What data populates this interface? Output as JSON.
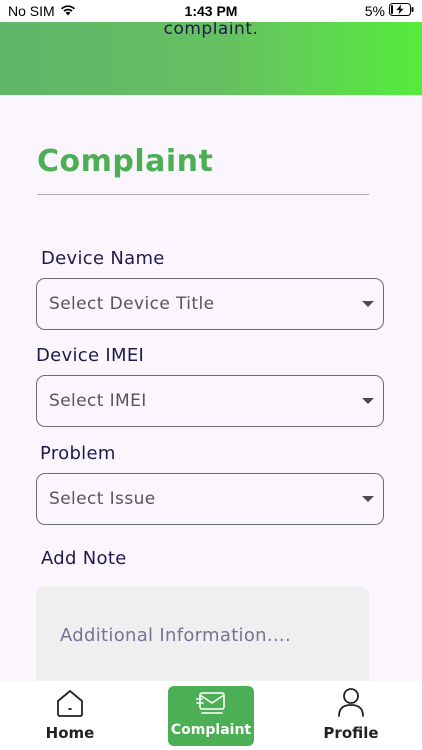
{
  "status_bar": {
    "carrier": "No SIM",
    "time": "1:43 PM",
    "battery": "5%"
  },
  "header": {
    "text": "complaint."
  },
  "form": {
    "title": "Complaint",
    "device_name": {
      "label": "Device Name",
      "placeholder": "Select Device Title"
    },
    "device_imei": {
      "label": "Device IMEI",
      "placeholder": "Select IMEI"
    },
    "problem": {
      "label": "Problem",
      "placeholder": "Select Issue"
    },
    "note": {
      "label": "Add Note",
      "placeholder": "Additional Information...."
    }
  },
  "bottom_nav": {
    "items": [
      {
        "label": "Home",
        "icon": "home-icon"
      },
      {
        "label": "Complaint",
        "icon": "complaint-icon",
        "active": true
      },
      {
        "label": "Profile",
        "icon": "profile-icon"
      }
    ]
  },
  "colors": {
    "accent": "#4caf55",
    "header_gradient_end": "#55ec3e",
    "text": "#1e1a4d"
  }
}
